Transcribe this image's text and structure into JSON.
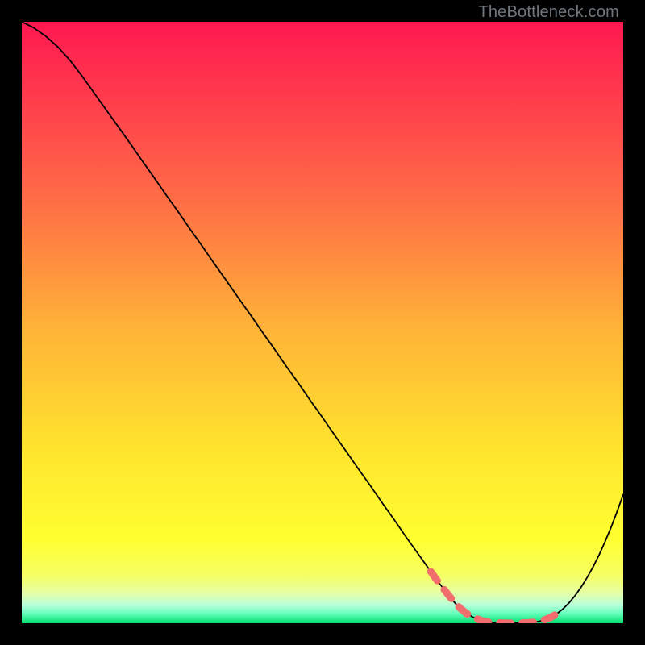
{
  "attribution": "TheBottleneck.com",
  "colors": {
    "dash": "#f26e6e",
    "line": "#000000",
    "frame": "#000000"
  },
  "chart_data": {
    "type": "line",
    "title": "",
    "xlabel": "",
    "ylabel": "",
    "xlim": [
      0,
      100
    ],
    "ylim": [
      0,
      100
    ],
    "grid": false,
    "legend": false,
    "x": [
      0,
      2,
      4,
      6,
      8,
      10,
      12,
      14,
      16,
      18,
      20,
      22,
      24,
      26,
      28,
      30,
      32,
      34,
      36,
      38,
      40,
      42,
      44,
      46,
      48,
      50,
      52,
      54,
      56,
      58,
      60,
      62,
      64,
      66,
      67,
      68,
      69,
      70,
      71,
      72,
      73,
      74,
      75,
      76,
      77,
      78,
      79,
      80,
      81,
      82,
      83,
      84,
      85,
      86,
      87,
      88,
      89,
      90,
      91,
      92,
      93,
      94,
      95,
      96,
      97,
      98,
      99,
      100
    ],
    "y": [
      100,
      99.0,
      97.6,
      95.8,
      93.6,
      91.0,
      88.2,
      85.4,
      82.6,
      79.8,
      76.9,
      74.1,
      71.2,
      68.4,
      65.5,
      62.7,
      59.8,
      57.0,
      54.1,
      51.3,
      48.4,
      45.6,
      42.7,
      39.9,
      37.0,
      34.2,
      31.3,
      28.5,
      25.6,
      22.8,
      19.9,
      17.1,
      14.2,
      11.4,
      10.0,
      8.6,
      7.2,
      5.9,
      4.6,
      3.4,
      2.4,
      1.6,
      1.0,
      0.6,
      0.3,
      0.15,
      0.08,
      0.04,
      0.02,
      0.02,
      0.04,
      0.08,
      0.15,
      0.3,
      0.6,
      1.0,
      1.6,
      2.4,
      3.4,
      4.6,
      6.0,
      7.6,
      9.4,
      11.4,
      13.6,
      16.0,
      18.6,
      21.4
    ],
    "optimal_range_x": [
      68,
      90
    ],
    "note": "y is bottleneck percentage (100 = worst, 0 = perfect match); optimal_range_x marks the dashed highlighted region"
  }
}
